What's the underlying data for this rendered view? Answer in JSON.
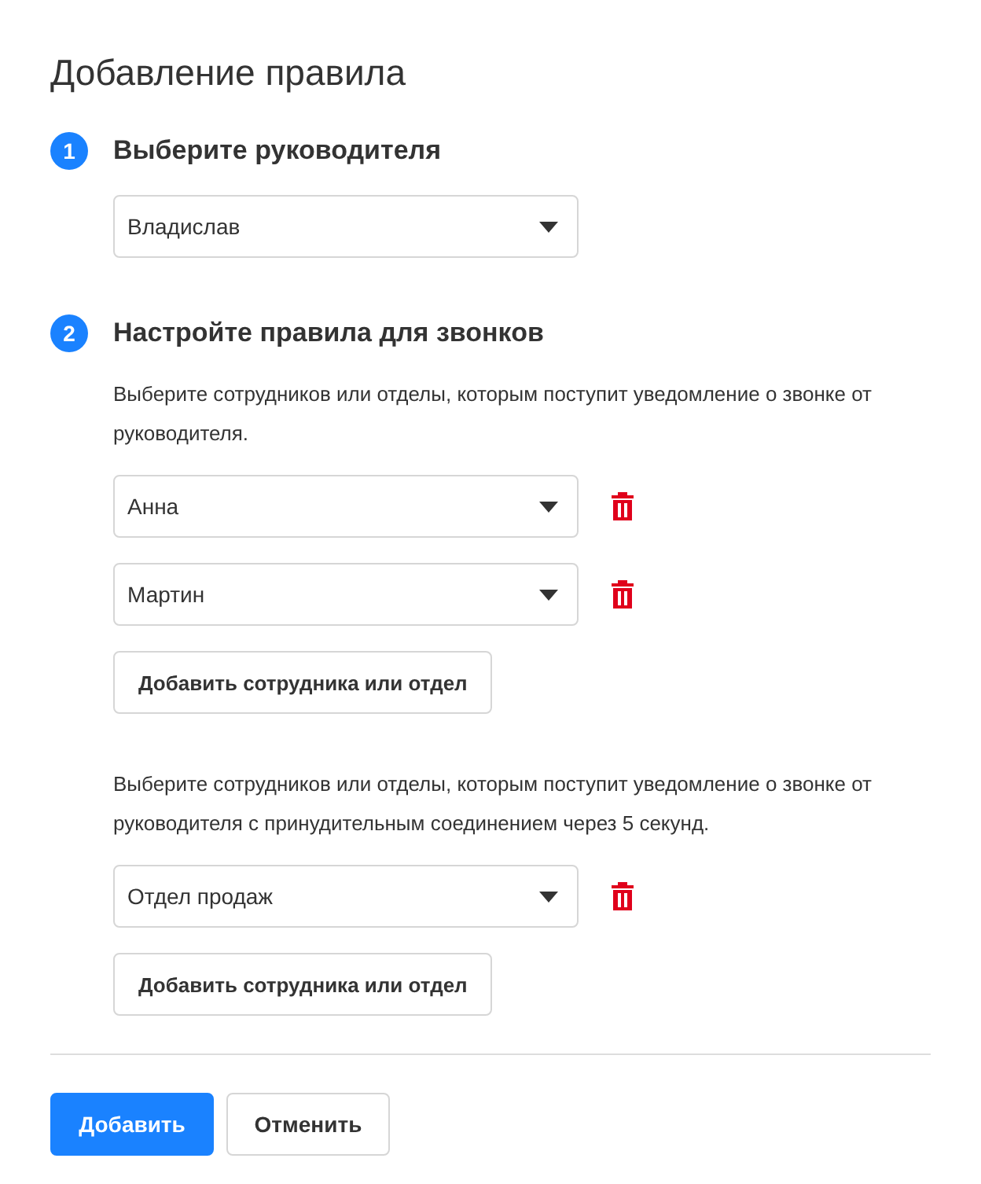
{
  "title": "Добавление правила",
  "step_1": {
    "number": "1",
    "title": "Выберите руководителя",
    "select": {
      "value": "Владислав"
    }
  },
  "step_2": {
    "number": "2",
    "title": "Настройте правила для звонков",
    "groups": [
      {
        "description": "Выберите сотрудников или отделы, которым поступит уведомление о звонке от руководителя.",
        "selects": [
          {
            "value": "Анна"
          },
          {
            "value": "Мартин"
          }
        ],
        "add_button": "Добавить сотрудника или отдел"
      },
      {
        "description": "Выберите сотрудников или отделы, которым поступит уведомление о звонке от руководителя с принудительным соединением через 5 секунд.",
        "selects": [
          {
            "value": "Отдел продаж"
          }
        ],
        "add_button": "Добавить сотрудника или отдел"
      }
    ]
  },
  "buttons": {
    "primary": "Добавить",
    "secondary": "Отменить"
  }
}
